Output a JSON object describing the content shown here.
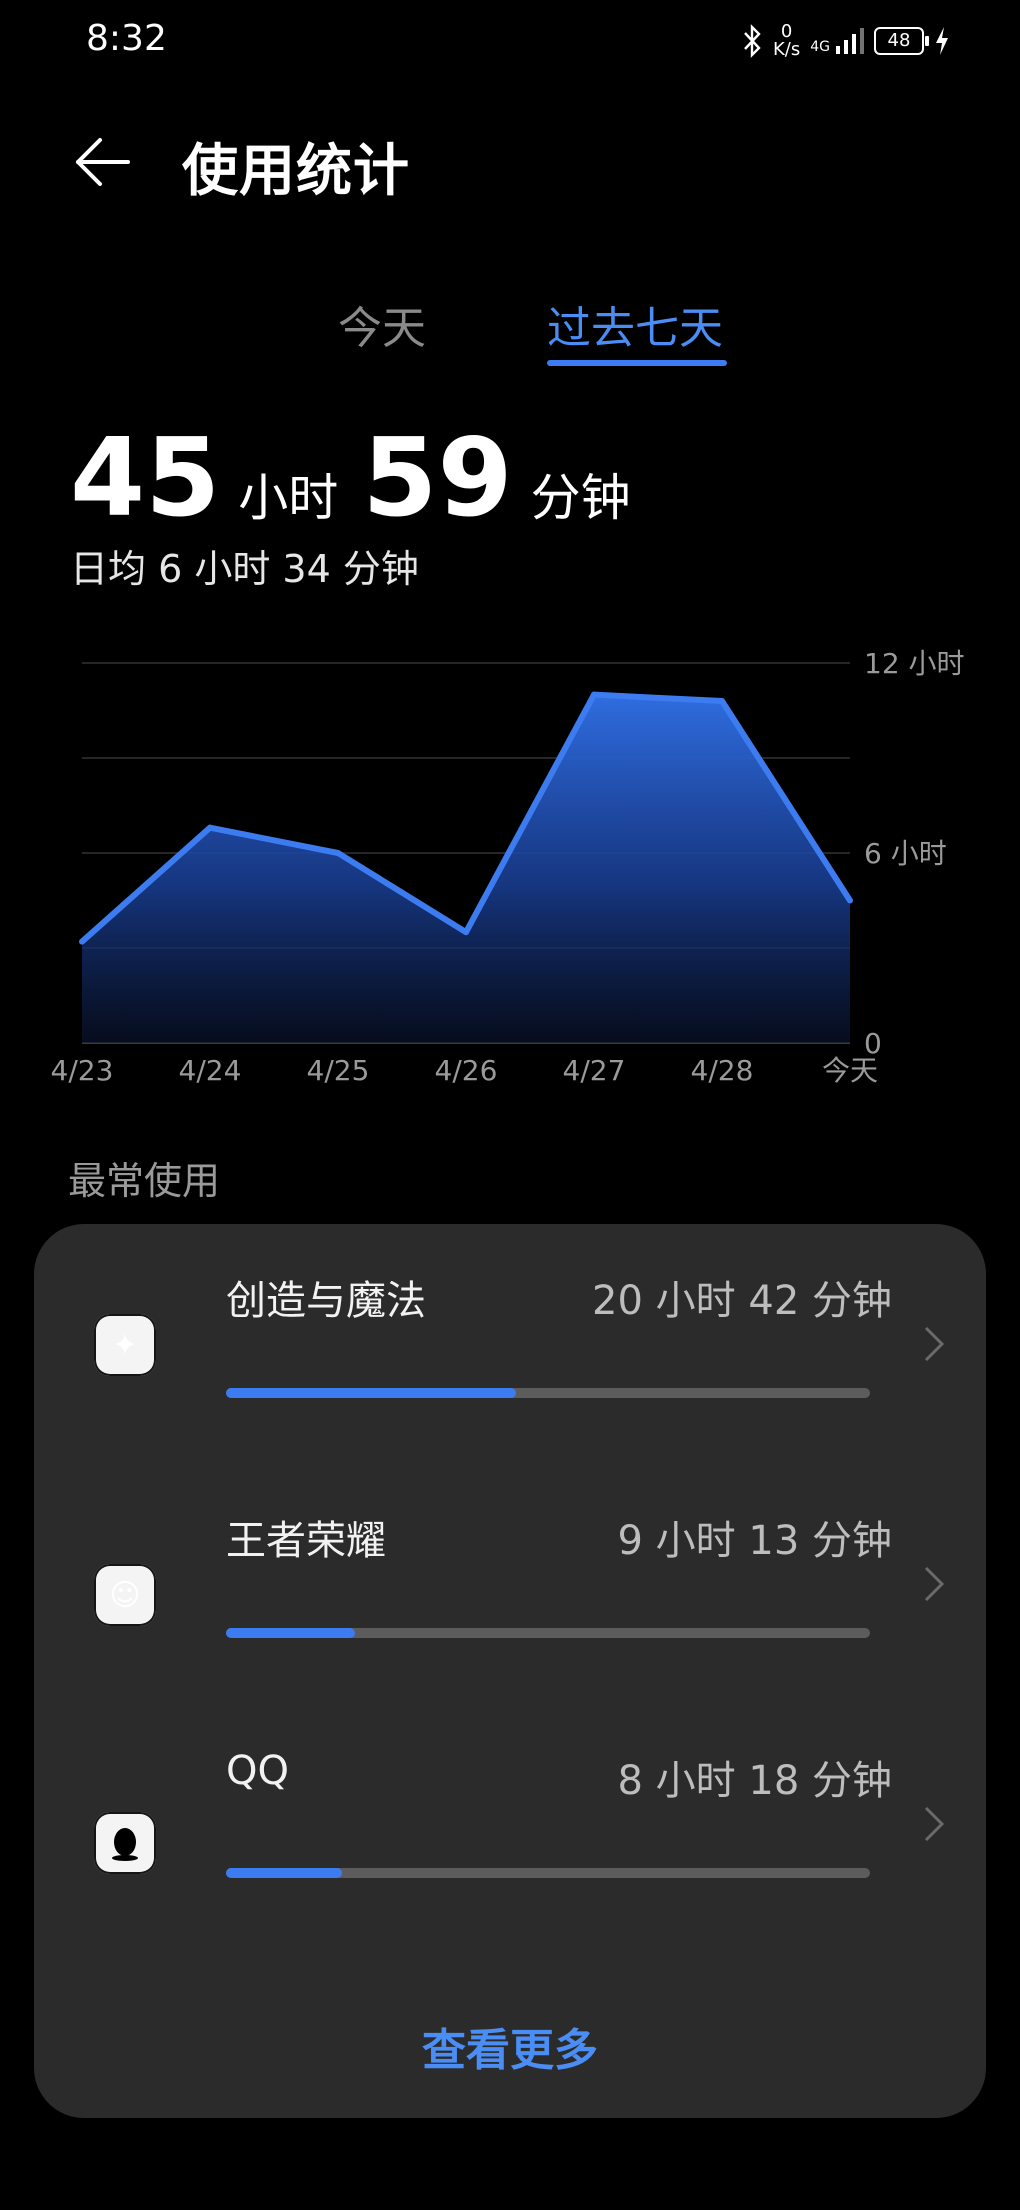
{
  "status_bar": {
    "time": "8:32",
    "net_value": "0",
    "net_unit": "K/s",
    "signal_label": "4G",
    "battery": "48",
    "icons": [
      "bluetooth-icon",
      "signal-icon",
      "battery-icon",
      "charging-icon"
    ]
  },
  "header": {
    "title": "使用统计"
  },
  "tabs": [
    {
      "label": "今天",
      "selected": false
    },
    {
      "label": "过去七天",
      "selected": true
    }
  ],
  "summary": {
    "hours": "45",
    "hours_unit": "小时",
    "minutes": "59",
    "minutes_unit": "分钟",
    "daily_avg": "日均 6 小时 34 分钟"
  },
  "chart_data": {
    "type": "area",
    "x": [
      "4/23",
      "4/24",
      "4/25",
      "4/26",
      "4/27",
      "4/28",
      "今天"
    ],
    "values": [
      3.2,
      6.8,
      6.0,
      3.5,
      11.0,
      10.8,
      4.5
    ],
    "y_ticks": [
      "0",
      "6 小时",
      "12 小时"
    ],
    "ylim": [
      0,
      12
    ],
    "line_color": "#3c7cf0"
  },
  "most_used": {
    "title": "最常使用",
    "apps": [
      {
        "name": "创造与魔法",
        "time": "20 小时 42 分钟",
        "fraction": 0.45,
        "icon": "game-character-icon"
      },
      {
        "name": "王者荣耀",
        "time": "9 小时 13 分钟",
        "fraction": 0.2,
        "icon": "hero-portrait-icon"
      },
      {
        "name": "QQ",
        "time": "8 小时 18 分钟",
        "fraction": 0.18,
        "icon": "penguin-icon"
      }
    ],
    "more_label": "查看更多"
  },
  "colors": {
    "accent": "#3c7cf0",
    "card": "#2b2b2b",
    "background": "#000000"
  }
}
